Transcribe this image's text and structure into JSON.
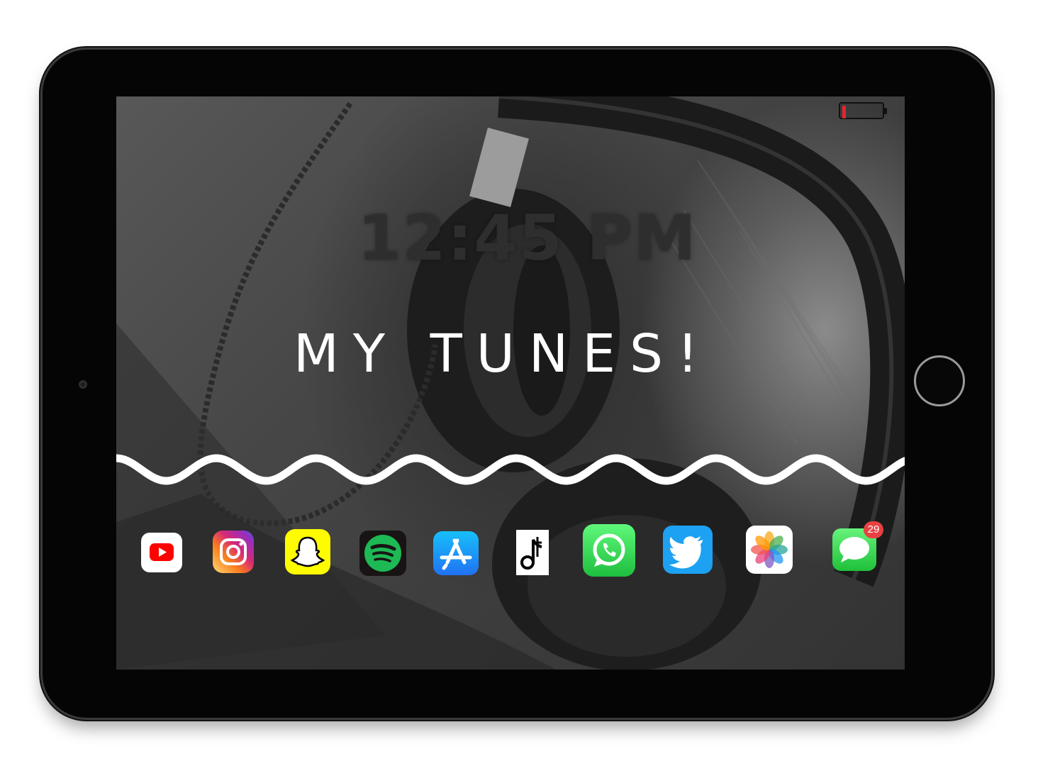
{
  "status_bar": {
    "battery_level_fraction": 0.08,
    "battery_color": "#e3262b"
  },
  "lock_screen": {
    "time": "12:45 PM",
    "headline": "MY TUNES!"
  },
  "dock": {
    "apps": [
      {
        "name": "YouTube",
        "icon": "youtube-icon",
        "color": "#ff0000"
      },
      {
        "name": "Instagram",
        "icon": "instagram-icon",
        "color": "#d62976"
      },
      {
        "name": "Snapchat",
        "icon": "snapchat-icon",
        "color": "#fffc00"
      },
      {
        "name": "Spotify",
        "icon": "spotify-icon",
        "color": "#1db954"
      },
      {
        "name": "App Store",
        "icon": "app-store-icon",
        "color": "#1a8cff"
      },
      {
        "name": "TikTok",
        "icon": "tiktok-icon",
        "color": "#000000"
      },
      {
        "name": "WhatsApp",
        "icon": "whatsapp-icon",
        "color": "#25d366"
      },
      {
        "name": "Twitter",
        "icon": "twitter-icon",
        "color": "#1da1f2"
      },
      {
        "name": "Photos",
        "icon": "photos-icon",
        "color": "#ffffff"
      },
      {
        "name": "Messages",
        "icon": "messages-icon",
        "color": "#34c759",
        "badge": "29"
      }
    ]
  }
}
